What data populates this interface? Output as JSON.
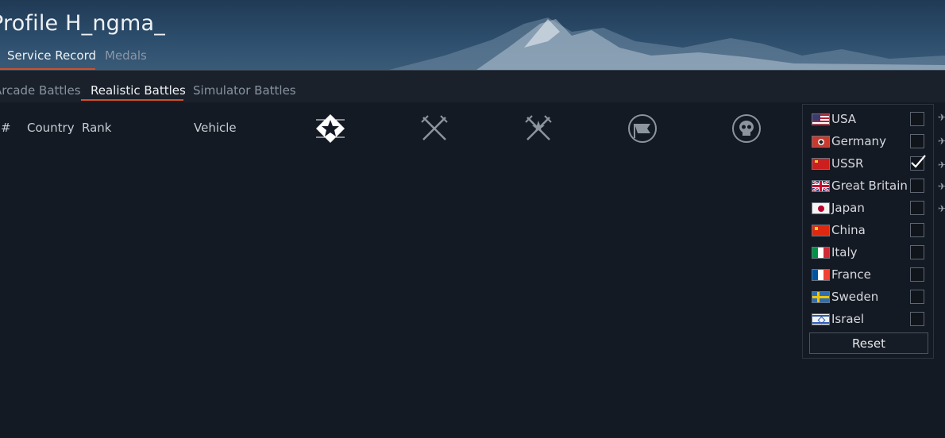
{
  "header": {
    "title": "Profile H_ngma_",
    "tabs": [
      {
        "label": "Service Record",
        "active": true
      },
      {
        "label": "Medals",
        "active": false
      }
    ]
  },
  "battle_tabs": [
    {
      "label": "Arcade Battles",
      "active": false
    },
    {
      "label": "Realistic Battles",
      "active": true
    },
    {
      "label": "Simulator Battles",
      "active": false
    }
  ],
  "table": {
    "columns": [
      "#",
      "Country",
      "Rank",
      "Vehicle"
    ],
    "stat_icons": [
      "star-emblem-icon",
      "crossed-swords-icon",
      "crossed-swords-star-icon",
      "flag-circle-icon",
      "skull-circle-icon"
    ]
  },
  "country_filter": {
    "countries": [
      {
        "name": "USA",
        "checked": false
      },
      {
        "name": "Germany",
        "checked": false
      },
      {
        "name": "USSR",
        "checked": true
      },
      {
        "name": "Great Britain",
        "checked": false
      },
      {
        "name": "Japan",
        "checked": false
      },
      {
        "name": "China",
        "checked": false
      },
      {
        "name": "Italy",
        "checked": false
      },
      {
        "name": "France",
        "checked": false
      },
      {
        "name": "Sweden",
        "checked": false
      },
      {
        "name": "Israel",
        "checked": false
      }
    ],
    "reset_label": "Reset"
  },
  "colors": {
    "accent": "#d0502c",
    "background": "#141a23",
    "checkmark": "#ffffff"
  }
}
